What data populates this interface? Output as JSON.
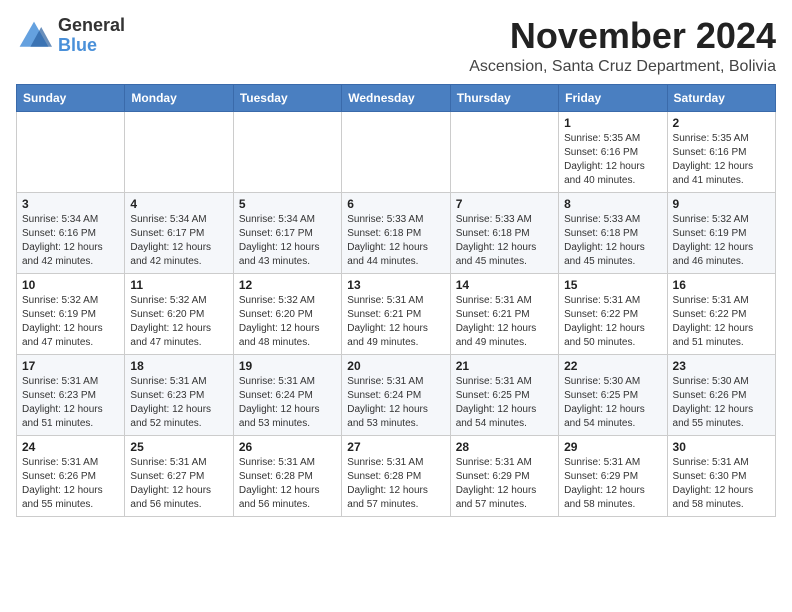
{
  "header": {
    "logo_line1": "General",
    "logo_line2": "Blue",
    "month_title": "November 2024",
    "location": "Ascension, Santa Cruz Department, Bolivia"
  },
  "weekdays": [
    "Sunday",
    "Monday",
    "Tuesday",
    "Wednesday",
    "Thursday",
    "Friday",
    "Saturday"
  ],
  "weeks": [
    [
      {
        "day": "",
        "info": ""
      },
      {
        "day": "",
        "info": ""
      },
      {
        "day": "",
        "info": ""
      },
      {
        "day": "",
        "info": ""
      },
      {
        "day": "",
        "info": ""
      },
      {
        "day": "1",
        "info": "Sunrise: 5:35 AM\nSunset: 6:16 PM\nDaylight: 12 hours\nand 40 minutes."
      },
      {
        "day": "2",
        "info": "Sunrise: 5:35 AM\nSunset: 6:16 PM\nDaylight: 12 hours\nand 41 minutes."
      }
    ],
    [
      {
        "day": "3",
        "info": "Sunrise: 5:34 AM\nSunset: 6:16 PM\nDaylight: 12 hours\nand 42 minutes."
      },
      {
        "day": "4",
        "info": "Sunrise: 5:34 AM\nSunset: 6:17 PM\nDaylight: 12 hours\nand 42 minutes."
      },
      {
        "day": "5",
        "info": "Sunrise: 5:34 AM\nSunset: 6:17 PM\nDaylight: 12 hours\nand 43 minutes."
      },
      {
        "day": "6",
        "info": "Sunrise: 5:33 AM\nSunset: 6:18 PM\nDaylight: 12 hours\nand 44 minutes."
      },
      {
        "day": "7",
        "info": "Sunrise: 5:33 AM\nSunset: 6:18 PM\nDaylight: 12 hours\nand 45 minutes."
      },
      {
        "day": "8",
        "info": "Sunrise: 5:33 AM\nSunset: 6:18 PM\nDaylight: 12 hours\nand 45 minutes."
      },
      {
        "day": "9",
        "info": "Sunrise: 5:32 AM\nSunset: 6:19 PM\nDaylight: 12 hours\nand 46 minutes."
      }
    ],
    [
      {
        "day": "10",
        "info": "Sunrise: 5:32 AM\nSunset: 6:19 PM\nDaylight: 12 hours\nand 47 minutes."
      },
      {
        "day": "11",
        "info": "Sunrise: 5:32 AM\nSunset: 6:20 PM\nDaylight: 12 hours\nand 47 minutes."
      },
      {
        "day": "12",
        "info": "Sunrise: 5:32 AM\nSunset: 6:20 PM\nDaylight: 12 hours\nand 48 minutes."
      },
      {
        "day": "13",
        "info": "Sunrise: 5:31 AM\nSunset: 6:21 PM\nDaylight: 12 hours\nand 49 minutes."
      },
      {
        "day": "14",
        "info": "Sunrise: 5:31 AM\nSunset: 6:21 PM\nDaylight: 12 hours\nand 49 minutes."
      },
      {
        "day": "15",
        "info": "Sunrise: 5:31 AM\nSunset: 6:22 PM\nDaylight: 12 hours\nand 50 minutes."
      },
      {
        "day": "16",
        "info": "Sunrise: 5:31 AM\nSunset: 6:22 PM\nDaylight: 12 hours\nand 51 minutes."
      }
    ],
    [
      {
        "day": "17",
        "info": "Sunrise: 5:31 AM\nSunset: 6:23 PM\nDaylight: 12 hours\nand 51 minutes."
      },
      {
        "day": "18",
        "info": "Sunrise: 5:31 AM\nSunset: 6:23 PM\nDaylight: 12 hours\nand 52 minutes."
      },
      {
        "day": "19",
        "info": "Sunrise: 5:31 AM\nSunset: 6:24 PM\nDaylight: 12 hours\nand 53 minutes."
      },
      {
        "day": "20",
        "info": "Sunrise: 5:31 AM\nSunset: 6:24 PM\nDaylight: 12 hours\nand 53 minutes."
      },
      {
        "day": "21",
        "info": "Sunrise: 5:31 AM\nSunset: 6:25 PM\nDaylight: 12 hours\nand 54 minutes."
      },
      {
        "day": "22",
        "info": "Sunrise: 5:30 AM\nSunset: 6:25 PM\nDaylight: 12 hours\nand 54 minutes."
      },
      {
        "day": "23",
        "info": "Sunrise: 5:30 AM\nSunset: 6:26 PM\nDaylight: 12 hours\nand 55 minutes."
      }
    ],
    [
      {
        "day": "24",
        "info": "Sunrise: 5:31 AM\nSunset: 6:26 PM\nDaylight: 12 hours\nand 55 minutes."
      },
      {
        "day": "25",
        "info": "Sunrise: 5:31 AM\nSunset: 6:27 PM\nDaylight: 12 hours\nand 56 minutes."
      },
      {
        "day": "26",
        "info": "Sunrise: 5:31 AM\nSunset: 6:28 PM\nDaylight: 12 hours\nand 56 minutes."
      },
      {
        "day": "27",
        "info": "Sunrise: 5:31 AM\nSunset: 6:28 PM\nDaylight: 12 hours\nand 57 minutes."
      },
      {
        "day": "28",
        "info": "Sunrise: 5:31 AM\nSunset: 6:29 PM\nDaylight: 12 hours\nand 57 minutes."
      },
      {
        "day": "29",
        "info": "Sunrise: 5:31 AM\nSunset: 6:29 PM\nDaylight: 12 hours\nand 58 minutes."
      },
      {
        "day": "30",
        "info": "Sunrise: 5:31 AM\nSunset: 6:30 PM\nDaylight: 12 hours\nand 58 minutes."
      }
    ]
  ]
}
